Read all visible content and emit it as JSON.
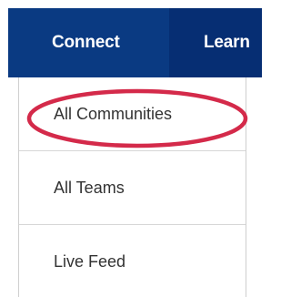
{
  "nav": {
    "tabs": [
      {
        "label": "Connect",
        "active": true
      },
      {
        "label": "Learn",
        "active": false
      }
    ]
  },
  "dropdown": {
    "items": [
      {
        "label": "All Communities",
        "highlighted": true
      },
      {
        "label": "All Teams"
      },
      {
        "label": "Live Feed"
      }
    ]
  },
  "colors": {
    "nav_bg": "#062e73",
    "nav_active_bg": "#0a3a82",
    "highlight_ring": "#d42a4a"
  }
}
